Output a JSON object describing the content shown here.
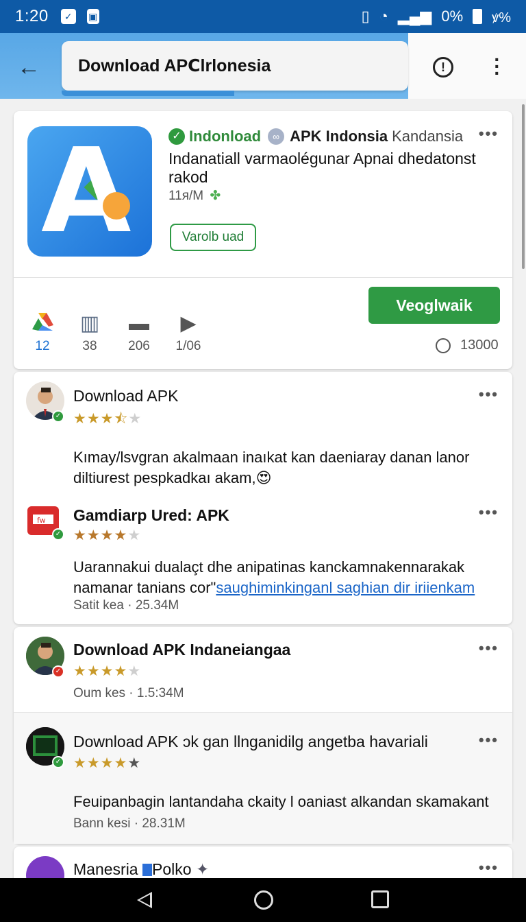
{
  "status_bar": {
    "time": "1:20",
    "battery_text": "0%",
    "right_glyphs": "⚡"
  },
  "app_bar": {
    "search_value": "Download APⅭlrlonesia"
  },
  "main_app": {
    "developer": "Indonload",
    "app_name": "APK Indonsia",
    "app_name_sub": "Kandansia",
    "description": "Indanatiall varmaolégunar Apnai dhedatonst rakod",
    "size": "11ᴙ/M",
    "outline_button": "Varolb uad",
    "install_button": "Veoglwaik",
    "views": "13000",
    "stats": [
      {
        "icon": "drive-icon",
        "value": "12"
      },
      {
        "icon": "map-icon",
        "value": "38"
      },
      {
        "icon": "chat-icon",
        "value": "206"
      },
      {
        "icon": "play-icon",
        "value": "1/06"
      }
    ]
  },
  "entries": [
    {
      "title": "Download APK",
      "rating": 3.5,
      "text": "Kımay/lsvgran akalmaan inaıkat kan daeniaray danan lanor diltiurest pespkadkaı akam,",
      "emoji": "😍"
    },
    {
      "title": "Gamdiarp Ured: APK",
      "rating": 4,
      "text_plain": "Uarannakui dualaçt dhe anipatinas kanckamnakennarakak namanar tanians cor\"",
      "text_link": "saughiminkinganl saghian dir iriienkam",
      "meta_left": "Satit kea",
      "meta_right": "25.34M"
    },
    {
      "title": "Download APK Indaneiangaa",
      "rating": 4,
      "meta_left": "Oum kes",
      "meta_right": "1.5:34M"
    },
    {
      "title": "Download APK ɔk gan llnganidilg angetba havariali",
      "rating": 4.5,
      "text": "Feuipanbagin lantandaha ckaity l oaniast alkandan skamakant",
      "meta_left": "Bann kesi",
      "meta_right": "28.31M"
    },
    {
      "title": "Manesria",
      "title_suffix": "Polko"
    }
  ],
  "colors": {
    "status_bar": "#0e5aa6",
    "accent_green": "#2f9a44",
    "link_blue": "#1a65c8",
    "star_gold": "#c99a2a"
  }
}
